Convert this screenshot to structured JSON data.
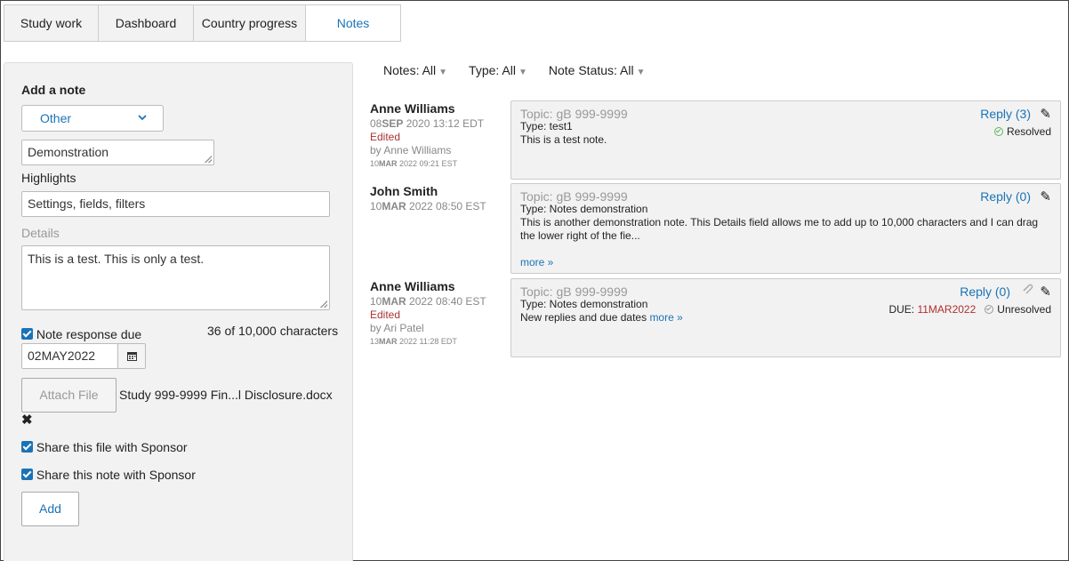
{
  "tabs": [
    {
      "label": "Study work"
    },
    {
      "label": "Dashboard"
    },
    {
      "label": "Country progress"
    },
    {
      "label": "Notes"
    }
  ],
  "add_note": {
    "heading": "Add a note",
    "category_select": "Other",
    "topic_value": "Demonstration",
    "highlights_label": "Highlights",
    "highlights_value": "Settings, fields, filters",
    "details_label": "Details",
    "details_value": "This is a test. This is only a test.",
    "response_due_label": "Note response due",
    "response_due_checked": true,
    "char_count": "36 of 10,000 characters",
    "due_date_value": "02MAY2022",
    "attach_label": "Attach File",
    "file_name": "Study 999-9999 Fin...l Disclosure.docx",
    "remove_file": "✖",
    "share_file_label": "Share this file with Sponsor",
    "share_note_label": "Share this note with Sponsor",
    "add_label": "Add"
  },
  "filters": [
    {
      "label": "Notes: All"
    },
    {
      "label": "Type: All"
    },
    {
      "label": "Note Status: All"
    }
  ],
  "notes": [
    {
      "author": "Anne Williams",
      "date_day": "08",
      "date_mon": "SEP",
      "date_rest": " 2020 13:12 EDT",
      "edited": "Edited",
      "edited_by": "by Anne Williams",
      "edited_day": "10",
      "edited_mon": "MAR",
      "edited_rest": " 2022 09:21 EST",
      "topic": "Topic: gB 999-9999",
      "type": "Type: test1",
      "body": "This is a test note.",
      "reply": "Reply (3)",
      "status": "Resolved"
    },
    {
      "author": "John Smith",
      "date_day": "10",
      "date_mon": "MAR",
      "date_rest": " 2022 08:50 EST",
      "topic": "Topic: gB 999-9999",
      "type": "Type: Notes demonstration",
      "body": "This is another demonstration note. This Details field allows me to add up to 10,000 characters and I can drag the lower right of the fie...",
      "more": "more »",
      "reply": "Reply (0)"
    },
    {
      "author": "Anne Williams",
      "date_day": "10",
      "date_mon": "MAR",
      "date_rest": " 2022 08:40 EST",
      "edited": "Edited",
      "edited_by": "by Ari Patel",
      "edited_day": "13",
      "edited_mon": "MAR",
      "edited_rest": " 2022 11:28 EDT",
      "topic": "Topic: gB 999-9999",
      "type": "Type: Notes demonstration",
      "body": "New replies and due dates",
      "more": "more »",
      "reply": "Reply (0)",
      "due_label": "DUE: ",
      "due_date": "11MAR2022",
      "status": "Unresolved"
    }
  ],
  "colors": {
    "accent": "#1a73b7",
    "panel_bg": "#f2f2f2",
    "edited": "#aa3333",
    "resolved": "#5bb55b"
  }
}
